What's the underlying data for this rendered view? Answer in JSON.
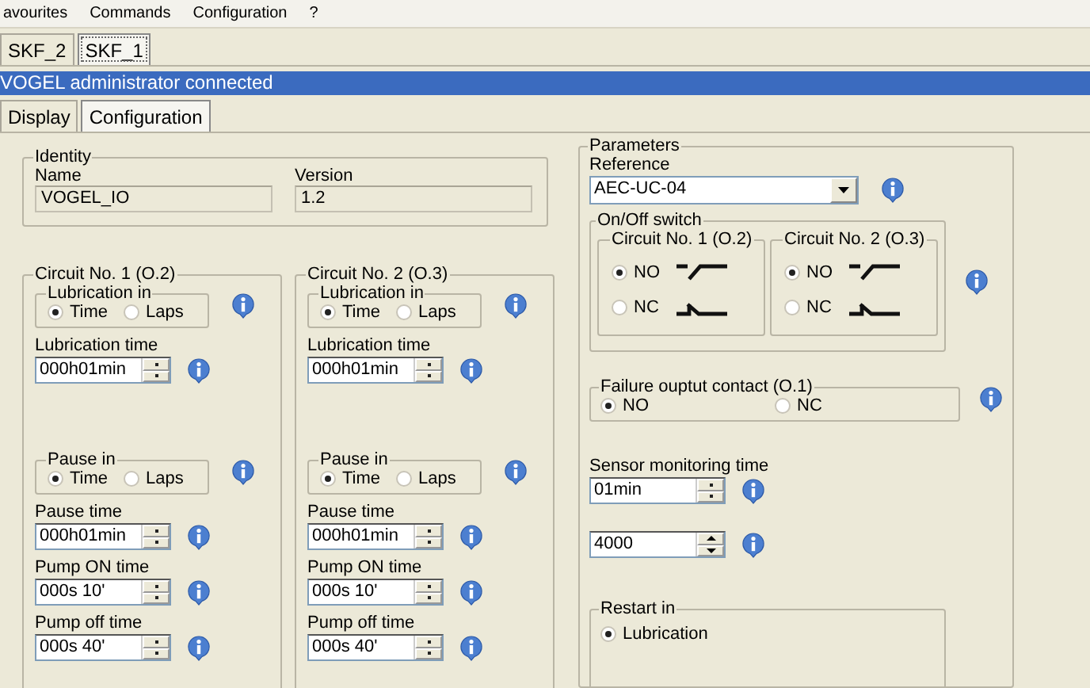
{
  "menu": [
    "avourites",
    "Commands",
    "Configuration",
    "?"
  ],
  "device_tabs": [
    {
      "label": "SKF_2",
      "selected": false
    },
    {
      "label": "SKF_1",
      "selected": true
    }
  ],
  "status_bar": "VOGEL administrator connected",
  "tabs": [
    {
      "label": "Display",
      "selected": false
    },
    {
      "label": "Configuration",
      "selected": true
    }
  ],
  "identity": {
    "title": "Identity",
    "fields": [
      {
        "label": "Name",
        "value": "VOGEL_IO"
      },
      {
        "label": "Version",
        "value": "1.2"
      }
    ]
  },
  "circuits": [
    {
      "title": "Circuit No. 1 (O.2)",
      "items": [
        {
          "kind": "radio_group",
          "title": "Lubrication in",
          "options": [
            {
              "label": "Time",
              "selected": true
            },
            {
              "label": "Laps",
              "selected": false
            }
          ]
        },
        {
          "kind": "spinner",
          "label": "Lubrication time",
          "value": "000h01min"
        },
        {
          "kind": "radio_group",
          "title": "Pause in",
          "options": [
            {
              "label": "Time",
              "selected": true
            },
            {
              "label": "Laps",
              "selected": false
            }
          ]
        },
        {
          "kind": "spinner",
          "label": "Pause time",
          "value": "000h01min"
        },
        {
          "kind": "spinner",
          "label": "Pump ON time",
          "value": "000s 10'"
        },
        {
          "kind": "spinner",
          "label": "Pump off time",
          "value": "000s 40'"
        }
      ]
    },
    {
      "title": "Circuit No. 2 (O.3)",
      "items": [
        {
          "kind": "radio_group",
          "title": "Lubrication in",
          "options": [
            {
              "label": "Time",
              "selected": true
            },
            {
              "label": "Laps",
              "selected": false
            }
          ]
        },
        {
          "kind": "spinner",
          "label": "Lubrication time",
          "value": "000h01min"
        },
        {
          "kind": "radio_group",
          "title": "Pause in",
          "options": [
            {
              "label": "Time",
              "selected": true
            },
            {
              "label": "Laps",
              "selected": false
            }
          ]
        },
        {
          "kind": "spinner",
          "label": "Pause time",
          "value": "000h01min"
        },
        {
          "kind": "spinner",
          "label": "Pump ON time",
          "value": "000s 10'"
        },
        {
          "kind": "spinner",
          "label": "Pump off time",
          "value": "000s 40'"
        }
      ]
    }
  ],
  "parameters": {
    "title": "Parameters",
    "reference": {
      "label": "Reference",
      "value": "AEC-UC-04"
    },
    "on_off_switch": {
      "title": "On/Off switch",
      "circuits": [
        {
          "title": "Circuit No. 1 (O.2)",
          "options": [
            {
              "label": "NO",
              "selected": true,
              "kind": "open"
            },
            {
              "label": "NC",
              "selected": false,
              "kind": "closed"
            }
          ]
        },
        {
          "title": "Circuit No. 2 (O.3)",
          "options": [
            {
              "label": "NO",
              "selected": true,
              "kind": "open"
            },
            {
              "label": "NC",
              "selected": false,
              "kind": "closed"
            }
          ]
        }
      ]
    },
    "failure_contact": {
      "title": "Failure ouptut contact (O.1)",
      "options": [
        {
          "label": "NO",
          "selected": true
        },
        {
          "label": "NC",
          "selected": false
        }
      ]
    },
    "sensor_time": {
      "label": "Sensor monitoring time",
      "value": "01min"
    },
    "counter": {
      "value": "4000"
    },
    "restart": {
      "title": "Restart in",
      "options": [
        {
          "label": "Lubrication",
          "selected": true
        }
      ]
    }
  }
}
